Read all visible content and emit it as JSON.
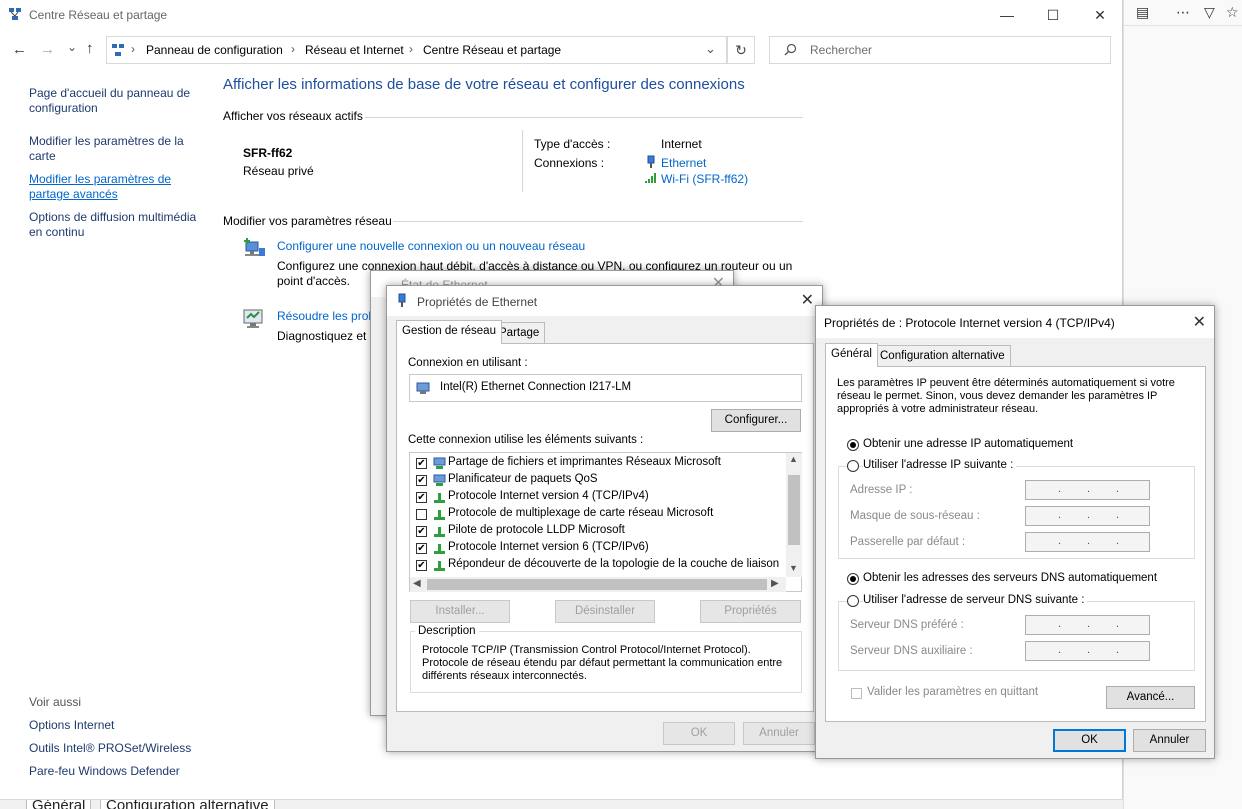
{
  "window": {
    "title": "Centre Réseau et partage",
    "minimize": "—",
    "maximize": "☐",
    "close": "✕"
  },
  "nav": {
    "back": "←",
    "forward": "→",
    "recent": "⌄",
    "up": "↑",
    "breadcrumb": [
      "Panneau de configuration",
      "Réseau et Internet",
      "Centre Réseau et partage"
    ],
    "sep": "›",
    "dropdown": "⌄",
    "refresh": "↻",
    "search_placeholder": "Rechercher"
  },
  "sidebar": {
    "items": [
      {
        "label": "Page d'accueil du panneau de configuration"
      },
      {
        "label": "Modifier les paramètres de la carte"
      },
      {
        "label": "Modifier les paramètres de partage avancés"
      },
      {
        "label": "Options de diffusion multimédia en continu"
      }
    ],
    "see_also_title": "Voir aussi",
    "see_also": [
      {
        "label": "Options Internet"
      },
      {
        "label": "Outils Intel® PROSet/Wireless"
      },
      {
        "label": "Pare-feu Windows Defender"
      }
    ]
  },
  "main": {
    "heading": "Afficher les informations de base de votre réseau et configurer des connexions",
    "active_section": "Afficher vos réseaux actifs",
    "network_name": "SFR-ff62",
    "network_type": "Réseau privé",
    "access_type_label": "Type d'accès :",
    "access_type_value": "Internet",
    "connections_label": "Connexions :",
    "connection_1": "Ethernet",
    "connection_2": "Wi-Fi (SFR-ff62)",
    "modify_section": "Modifier vos paramètres réseau",
    "task1_link": "Configurer une nouvelle connexion ou un nouveau réseau",
    "task1_desc1": "Configurez une connexion haut débit, d'accès à distance ou VPN, ou configurez un routeur ou un",
    "task1_desc2": "point d'accès.",
    "task2_link": "Résoudre les prob",
    "task2_desc": "Diagnostiquez et r"
  },
  "etat_dialog": {
    "title": "État de Ethernet"
  },
  "eth_props": {
    "title": "Propriétés de Ethernet",
    "tab_network": "Gestion de réseau",
    "tab_sharing": "Partage",
    "connect_using_label": "Connexion en utilisant :",
    "adapter": "Intel(R) Ethernet Connection I217-LM",
    "configure_btn": "Configurer...",
    "items_label": "Cette connexion utilise les éléments suivants :",
    "items": [
      {
        "label": "Partage de fichiers et imprimantes Réseaux Microsoft",
        "checked": "✔"
      },
      {
        "label": "Planificateur de paquets QoS",
        "checked": "✔"
      },
      {
        "label": "Protocole Internet version 4 (TCP/IPv4)",
        "checked": "✔"
      },
      {
        "label": "Protocole de multiplexage de carte réseau Microsoft",
        "checked": ""
      },
      {
        "label": "Pilote de protocole LLDP Microsoft",
        "checked": "✔"
      },
      {
        "label": "Protocole Internet version 6 (TCP/IPv6)",
        "checked": "✔"
      },
      {
        "label": "Répondeur de découverte de la topologie de la couche de liaison",
        "checked": "✔"
      }
    ],
    "install_btn": "Installer...",
    "uninstall_btn": "Désinstaller",
    "properties_btn": "Propriétés",
    "description_title": "Description",
    "description": "Protocole TCP/IP (Transmission Control Protocol/Internet Protocol). Protocole de réseau étendu par défaut permettant la communication entre différents réseaux interconnectés.",
    "ok_btn": "OK",
    "cancel_btn": "Annuler"
  },
  "ipv4_props": {
    "title": "Propriétés de : Protocole Internet version 4 (TCP/IPv4)",
    "tab_general": "Général",
    "tab_alternate": "Configuration alternative",
    "intro": "Les paramètres IP peuvent être déterminés automatiquement si votre réseau le permet. Sinon, vous devez demander les paramètres IP appropriés à votre administrateur réseau.",
    "auto_ip": "Obtenir une adresse IP automatiquement",
    "manual_ip": "Utiliser l'adresse IP suivante :",
    "ip_label": "Adresse IP :",
    "mask_label": "Masque de sous-réseau :",
    "gateway_label": "Passerelle par défaut :",
    "auto_dns": "Obtenir les adresses des serveurs DNS automatiquement",
    "manual_dns": "Utiliser l'adresse de serveur DNS suivante :",
    "dns1_label": "Serveur DNS préféré :",
    "dns2_label": "Serveur DNS auxiliaire :",
    "validate_label": "Valider les paramètres en quittant",
    "advanced_btn": "Avancé...",
    "ok_btn": "OK",
    "cancel_btn": "Annuler",
    "ip_dot": "."
  },
  "background": {
    "tab1": "Général",
    "tab2": "Configuration alternative"
  },
  "colors": {
    "link": "#0066cc",
    "heading": "#1e4e9e",
    "accent": "#0078d7"
  }
}
